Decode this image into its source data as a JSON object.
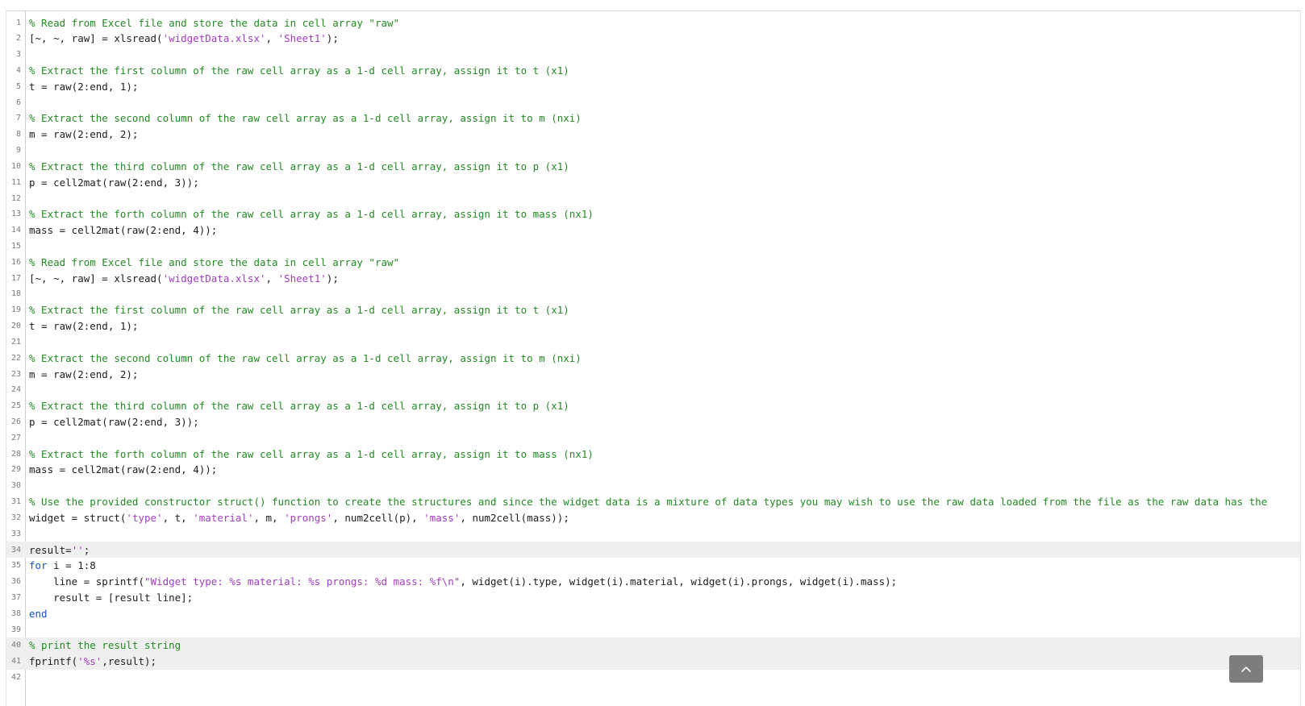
{
  "editor": {
    "lines": [
      {
        "n": "1",
        "seg": [
          {
            "t": "% Read from Excel file and store the data in cell array \"raw\"",
            "k": "comment"
          }
        ]
      },
      {
        "n": "2",
        "seg": [
          {
            "t": "[~, ~, raw] = xlsread(",
            "k": "def"
          },
          {
            "t": "'widgetData.xlsx'",
            "k": "str"
          },
          {
            "t": ", ",
            "k": "def"
          },
          {
            "t": "'Sheet1'",
            "k": "str"
          },
          {
            "t": ");",
            "k": "def"
          }
        ]
      },
      {
        "n": "3",
        "seg": []
      },
      {
        "n": "4",
        "seg": [
          {
            "t": "% Extract the first column of the raw cell array as a 1-d cell array, assign it to t (x1)",
            "k": "comment"
          }
        ]
      },
      {
        "n": "5",
        "seg": [
          {
            "t": "t = raw(2:end, 1);",
            "k": "def"
          }
        ]
      },
      {
        "n": "6",
        "seg": []
      },
      {
        "n": "7",
        "seg": [
          {
            "t": "% Extract the second column of the raw cell array as a 1-d cell array, assign it to m (nxi)",
            "k": "comment"
          }
        ]
      },
      {
        "n": "8",
        "seg": [
          {
            "t": "m = raw(2:end, 2);",
            "k": "def"
          }
        ]
      },
      {
        "n": "9",
        "seg": []
      },
      {
        "n": "10",
        "seg": [
          {
            "t": "% Extract the third column of the raw cell array as a 1-d cell array, assign it to p (x1)",
            "k": "comment"
          }
        ]
      },
      {
        "n": "11",
        "seg": [
          {
            "t": "p = cell2mat(raw(2:end, 3));",
            "k": "def"
          }
        ]
      },
      {
        "n": "12",
        "seg": []
      },
      {
        "n": "13",
        "seg": [
          {
            "t": "% Extract the forth column of the raw cell array as a 1-d cell array, assign it to mass (nx1)",
            "k": "comment"
          }
        ]
      },
      {
        "n": "14",
        "seg": [
          {
            "t": "mass = cell2mat(raw(2:end, 4));",
            "k": "def"
          }
        ]
      },
      {
        "n": "15",
        "seg": []
      },
      {
        "n": "16",
        "seg": [
          {
            "t": "% Read from Excel file and store the data in cell array \"raw\"",
            "k": "comment"
          }
        ]
      },
      {
        "n": "17",
        "seg": [
          {
            "t": "[~, ~, raw] = xlsread(",
            "k": "def"
          },
          {
            "t": "'widgetData.xlsx'",
            "k": "str"
          },
          {
            "t": ", ",
            "k": "def"
          },
          {
            "t": "'Sheet1'",
            "k": "str"
          },
          {
            "t": ");",
            "k": "def"
          }
        ]
      },
      {
        "n": "18",
        "seg": []
      },
      {
        "n": "19",
        "seg": [
          {
            "t": "% Extract the first column of the raw cell array as a 1-d cell array, assign it to t (x1)",
            "k": "comment"
          }
        ]
      },
      {
        "n": "20",
        "seg": [
          {
            "t": "t = raw(2:end, 1);",
            "k": "def"
          }
        ]
      },
      {
        "n": "21",
        "seg": []
      },
      {
        "n": "22",
        "seg": [
          {
            "t": "% Extract the second column of the raw cell array as a 1-d cell array, assign it to m (nxi)",
            "k": "comment"
          }
        ]
      },
      {
        "n": "23",
        "seg": [
          {
            "t": "m = raw(2:end, 2);",
            "k": "def"
          }
        ]
      },
      {
        "n": "24",
        "seg": []
      },
      {
        "n": "25",
        "seg": [
          {
            "t": "% Extract the third column of the raw cell array as a 1-d cell array, assign it to p (x1)",
            "k": "comment"
          }
        ]
      },
      {
        "n": "26",
        "seg": [
          {
            "t": "p = cell2mat(raw(2:end, 3));",
            "k": "def"
          }
        ]
      },
      {
        "n": "27",
        "seg": []
      },
      {
        "n": "28",
        "seg": [
          {
            "t": "% Extract the forth column of the raw cell array as a 1-d cell array, assign it to mass (nx1)",
            "k": "comment"
          }
        ]
      },
      {
        "n": "29",
        "seg": [
          {
            "t": "mass = cell2mat(raw(2:end, 4));",
            "k": "def"
          }
        ]
      },
      {
        "n": "30",
        "seg": []
      },
      {
        "n": "31",
        "seg": [
          {
            "t": "% Use the provided constructor struct() function to create the structures and since the widget data is a mixture of data types you may wish to use the raw data loaded from the file as the raw data has the",
            "k": "comment"
          }
        ]
      },
      {
        "n": "32",
        "seg": [
          {
            "t": "widget = struct(",
            "k": "def"
          },
          {
            "t": "'type'",
            "k": "str"
          },
          {
            "t": ", t, ",
            "k": "def"
          },
          {
            "t": "'material'",
            "k": "str"
          },
          {
            "t": ", m, ",
            "k": "def"
          },
          {
            "t": "'prongs'",
            "k": "str"
          },
          {
            "t": ", num2cell(p), ",
            "k": "def"
          },
          {
            "t": "'mass'",
            "k": "str"
          },
          {
            "t": ", num2cell(mass));",
            "k": "def"
          }
        ]
      },
      {
        "n": "33",
        "seg": []
      },
      {
        "n": "34",
        "seg": [
          {
            "t": "result=",
            "k": "def"
          },
          {
            "t": "''",
            "k": "str"
          },
          {
            "t": ";",
            "k": "def"
          }
        ],
        "hl": true
      },
      {
        "n": "35",
        "seg": [
          {
            "t": "for",
            "k": "kw"
          },
          {
            "t": " i = 1:8",
            "k": "def"
          }
        ]
      },
      {
        "n": "36",
        "seg": [
          {
            "t": "    line = sprintf(",
            "k": "def"
          },
          {
            "t": "\"Widget type: %s material: %s prongs: %d mass: %f\\n\"",
            "k": "str"
          },
          {
            "t": ", widget(i).type, widget(i).material, widget(i).prongs, widget(i).mass);",
            "k": "def"
          }
        ]
      },
      {
        "n": "37",
        "seg": [
          {
            "t": "    result = [result line];",
            "k": "def"
          }
        ]
      },
      {
        "n": "38",
        "seg": [
          {
            "t": "end",
            "k": "kw"
          }
        ]
      },
      {
        "n": "39",
        "seg": []
      },
      {
        "n": "40",
        "seg": [
          {
            "t": "% print the result string",
            "k": "comment"
          }
        ],
        "hl": true
      },
      {
        "n": "41",
        "seg": [
          {
            "t": "fprintf(",
            "k": "def"
          },
          {
            "t": "'%s'",
            "k": "str"
          },
          {
            "t": ",result);",
            "k": "def"
          }
        ],
        "hl": true
      },
      {
        "n": "42",
        "seg": []
      }
    ]
  },
  "colors": {
    "comment": "#228b22",
    "keyword": "#1a4fd6",
    "string": "#a13dc0",
    "default": "#202020",
    "highlight": "#efefef"
  },
  "scroll_button": {
    "icon": "chevron-up-icon"
  }
}
